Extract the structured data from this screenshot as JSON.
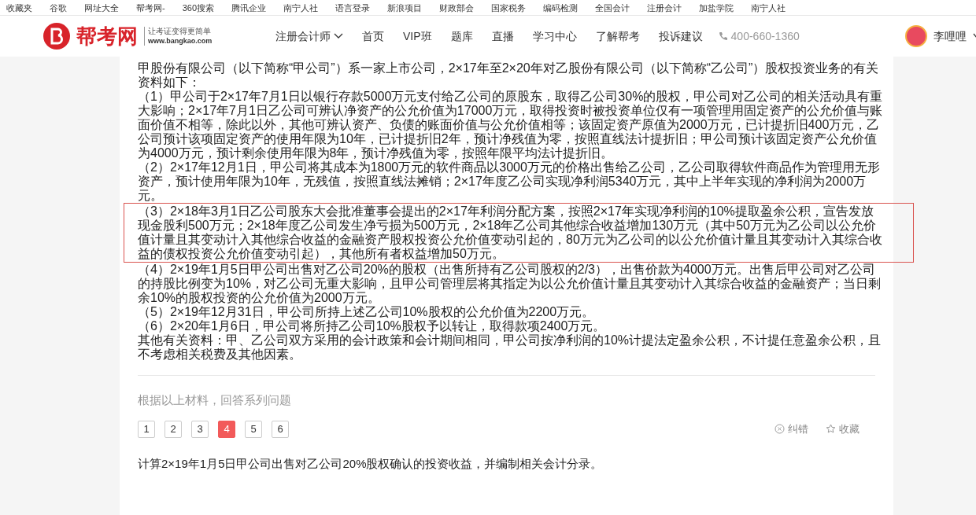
{
  "bookmarks": [
    "收藏夹",
    "谷歌",
    "网址大全",
    "帮考网-",
    "360搜索",
    "腾讯企业",
    "南宁人社",
    "语言登录",
    "新浪项目",
    "财政部会",
    "国家税务",
    "编码检测",
    "全国会计",
    "注册会计",
    "加盐学院",
    "南宁人社"
  ],
  "logo": {
    "name": "帮考网",
    "slogan": "让考证变得更简单",
    "url": "www.bangkao.com"
  },
  "nav": [
    {
      "label": "注册会计师",
      "dropdown": true
    },
    {
      "label": "首页",
      "dropdown": false
    },
    {
      "label": "VIP班",
      "dropdown": false
    },
    {
      "label": "题库",
      "dropdown": false
    },
    {
      "label": "直播",
      "dropdown": false
    },
    {
      "label": "学习中心",
      "dropdown": false
    },
    {
      "label": "了解帮考",
      "dropdown": false
    },
    {
      "label": "投诉建议",
      "dropdown": false
    }
  ],
  "phone": "400-660-1360",
  "user": {
    "name": "李哩哩"
  },
  "material": [
    {
      "text": "甲股份有限公司（以下简称“甲公司”）系一家上市公司，2×17年至2×20年对乙股份有限公司（以下简称“乙公司”）股权投资业务的有关资料如下：",
      "highlighted": false
    },
    {
      "text": "（1）甲公司于2×17年7月1日以银行存款5000万元支付给乙公司的原股东，取得乙公司30%的股权，甲公司对乙公司的相关活动具有重大影响；2×17年7月1日乙公司可辨认净资产的公允价值为17000万元，取得投资时被投资单位仅有一项管理用固定资产的公允价值与账面价值不相等，除此以外，其他可辨认资产、负债的账面价值与公允价值相等；该固定资产原值为2000万元，已计提折旧400万元，乙公司预计该项固定资产的使用年限为10年，已计提折旧2年，预计净残值为零，按照直线法计提折旧；甲公司预计该固定资产公允价值为4000万元，预计剩余使用年限为8年，预计净残值为零，按照年限平均法计提折旧。",
      "highlighted": false
    },
    {
      "text": "（2）2×17年12月1日，甲公司将其成本为1800万元的软件商品以3000万元的价格出售给乙公司，乙公司取得软件商品作为管理用无形资产，预计使用年限为10年，无残值，按照直线法摊销；2×17年度乙公司实现净利润5340万元，其中上半年实现的净利润为2000万元。",
      "highlighted": false
    },
    {
      "text": "（3）2×18年3月1日乙公司股东大会批准董事会提出的2×17年利润分配方案，按照2×17年实现净利润的10%提取盈余公积，宣告发放现金股利500万元；2×18年度乙公司发生净亏损为500万元，2×18年乙公司其他综合收益增加130万元（其中50万元为乙公司以公允价值计量且其变动计入其他综合收益的金融资产股权投资公允价值变动引起的，80万元为乙公司的以公允价值计量且其变动计入其综合收益的债权投资公允价值变动引起），其他所有者权益增加50万元。",
      "highlighted": true
    },
    {
      "text": "（4）2×19年1月5日甲公司出售对乙公司20%的股权（出售所持有乙公司股权的2/3），出售价款为4000万元。出售后甲公司对乙公司的持股比例变为10%，对乙公司无重大影响，且甲公司管理层将其指定为以公允价值计量且其变动计入其综合收益的金融资产；当日剩余10%的股权投资的公允价值为2000万元。",
      "highlighted": false
    },
    {
      "text": "（5）2×19年12月31日，甲公司所持上述乙公司10%股权的公允价值为2200万元。",
      "highlighted": false
    },
    {
      "text": "（6）2×20年1月6日，甲公司将所持乙公司10%股权予以转让，取得款项2400万元。",
      "highlighted": false
    },
    {
      "text": "其他有关资料：甲、乙公司双方采用的会计政策和会计期间相同，甲公司按净利润的10%计提法定盈余公积，不计提任意盈余公积，且不考虑相关税费及其他因素。",
      "highlighted": false
    }
  ],
  "prompt": "根据以上材料，回答系列问题",
  "questions": [
    {
      "label": "1",
      "selected": false
    },
    {
      "label": "2",
      "selected": false
    },
    {
      "label": "3",
      "selected": false
    },
    {
      "label": "4",
      "selected": true
    },
    {
      "label": "5",
      "selected": false
    },
    {
      "label": "6",
      "selected": false
    }
  ],
  "actions": [
    {
      "kind": "report",
      "label": "纠错"
    },
    {
      "kind": "favorite",
      "label": "收藏"
    }
  ],
  "question_text": "计算2×19年1月5日甲公司出售对乙公司20%股权确认的投资收益，并编制相关会计分录。"
}
